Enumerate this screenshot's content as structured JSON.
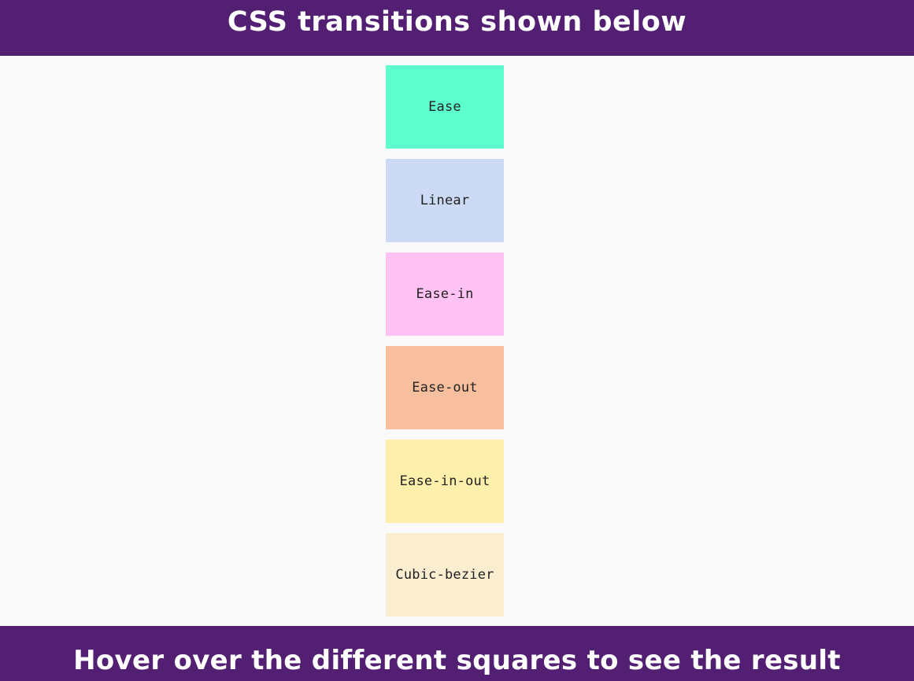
{
  "header": {
    "title": "CSS transitions shown below"
  },
  "boxes": [
    {
      "label": "Ease",
      "color": "#5dffcc"
    },
    {
      "label": "Linear",
      "color": "#ccdaf5"
    },
    {
      "label": "Ease-in",
      "color": "#ffc2f2"
    },
    {
      "label": "Ease-out",
      "color": "#f7bf9e"
    },
    {
      "label": "Ease-in-out",
      "color": "#ffefad"
    },
    {
      "label": "Cubic-bezier",
      "color": "#fbedd0"
    }
  ],
  "footer": {
    "text": "Hover over the different squares to see the result"
  },
  "theme": {
    "banner_color": "#521f73",
    "background_color": "#fafafa"
  }
}
